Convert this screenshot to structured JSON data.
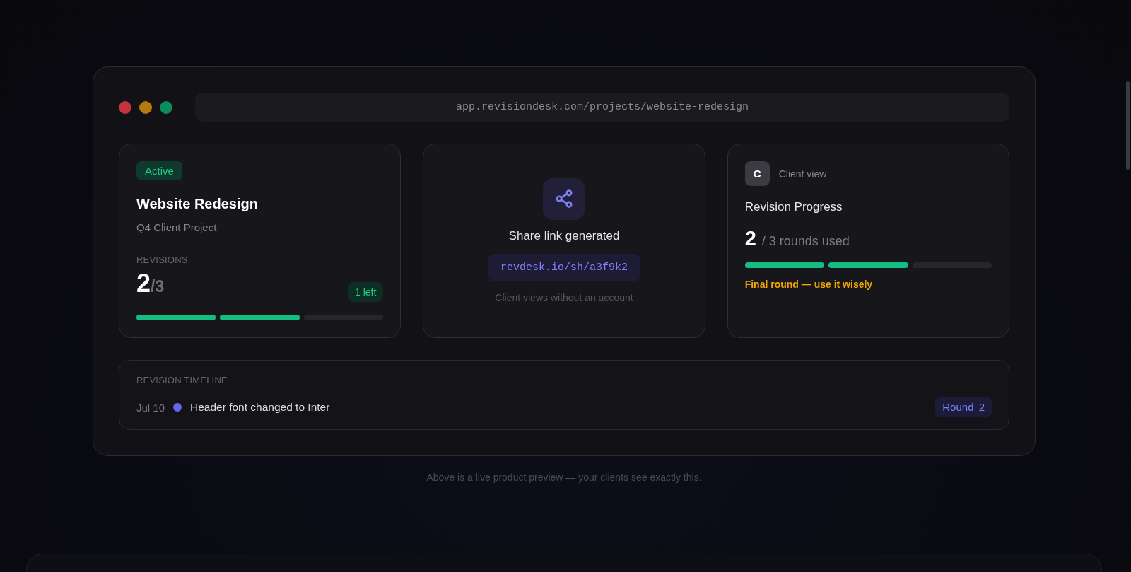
{
  "browser": {
    "window_controls": [
      {
        "color": "#c1333f"
      },
      {
        "color": "#b87a10"
      },
      {
        "color": "#0c8b5e"
      }
    ],
    "address": "app.revisiondesk.com/projects/website-redesign"
  },
  "project_card": {
    "status": "Active",
    "title": "Website Redesign",
    "subtitle": "Q4 Client Project",
    "revisions_label": "REVISIONS",
    "used": "2",
    "total": "/3",
    "remaining": "1 left",
    "segments": [
      {
        "filled": true
      },
      {
        "filled": true
      },
      {
        "filled": false
      }
    ]
  },
  "share_card": {
    "title": "Share link generated",
    "link": "revdesk.io/sh/a3f9k2",
    "note": "Client views without an account"
  },
  "client_card": {
    "avatar": "C",
    "label": "Client view",
    "title": "Revision Progress",
    "used": "2",
    "total": "/ 3 rounds used",
    "segments": [
      {
        "filled": true
      },
      {
        "filled": true
      },
      {
        "filled": false
      }
    ],
    "warning": "Final round — use it wisely"
  },
  "timeline": {
    "title": "REVISION TIMELINE",
    "entries": [
      {
        "date": "Jul 10",
        "color": "#6366f1",
        "text": "Header font changed to Inter",
        "round": "Round 2"
      }
    ]
  },
  "caption": "Above is a live product preview — your clients see exactly this."
}
